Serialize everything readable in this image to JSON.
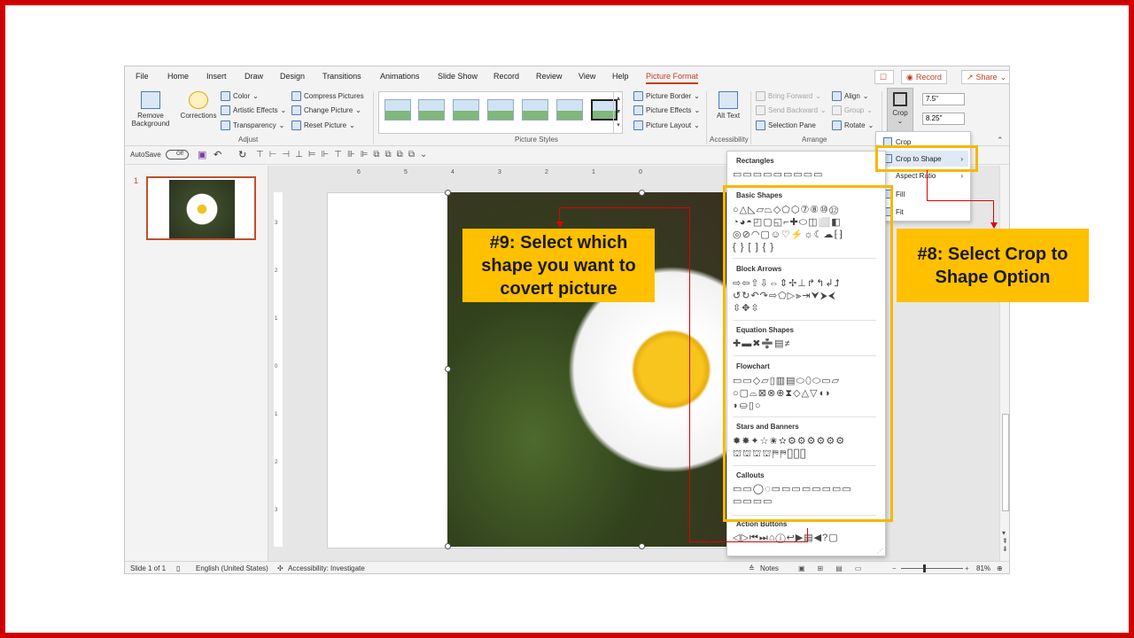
{
  "tabs": [
    "File",
    "Home",
    "Insert",
    "Draw",
    "Design",
    "Transitions",
    "Animations",
    "Slide Show",
    "Record",
    "Review",
    "View",
    "Help",
    "Picture Format"
  ],
  "title_buttons": {
    "record": "Record",
    "share": "Share"
  },
  "ribbon": {
    "adjust": {
      "remove_bg": "Remove Background",
      "corrections": "Corrections",
      "color": "Color",
      "artistic": "Artistic Effects",
      "transparency": "Transparency",
      "compress": "Compress Pictures",
      "change": "Change Picture",
      "reset": "Reset Picture",
      "group": "Adjust"
    },
    "styles": {
      "border": "Picture Border",
      "effects": "Picture Effects",
      "layout": "Picture Layout",
      "group": "Picture Styles"
    },
    "accessibility": {
      "alt_text": "Alt Text",
      "group": "Accessibility"
    },
    "arrange": {
      "bring_forward": "Bring Forward",
      "send_backward": "Send Backward",
      "selection_pane": "Selection Pane",
      "align": "Align",
      "group_btn": "Group",
      "rotate": "Rotate",
      "group": "Arrange"
    },
    "size": {
      "crop": "Crop",
      "height": "7.5\"",
      "width": "8.25\""
    }
  },
  "qat": {
    "autosave": "AutoSave",
    "toggle": "Off"
  },
  "slide_number": "1",
  "ruler_labels": [
    "6",
    "5",
    "4",
    "3",
    "2",
    "1",
    "0"
  ],
  "vruler_labels": [
    "3",
    "2",
    "1",
    "0",
    "1",
    "2",
    "3"
  ],
  "status": {
    "slide": "Slide 1 of 1",
    "language": "English (United States)",
    "accessibility": "Accessibility: Investigate",
    "notes": "Notes",
    "zoom": "81%"
  },
  "crop_menu": {
    "crop": "Crop",
    "crop_to_shape": "Crop to Shape",
    "aspect_ratio": "Aspect Ratio",
    "fill": "Fill",
    "fit": "Fit"
  },
  "shapes_gallery": {
    "rectangles": "Rectangles",
    "basic": "Basic Shapes",
    "arrows": "Block Arrows",
    "equation": "Equation Shapes",
    "flowchart": "Flowchart",
    "stars": "Stars and Banners",
    "callouts": "Callouts",
    "action": "Action Buttons"
  },
  "annotations": {
    "step8": "#8: Select Crop to Shape Option",
    "step9": "#9: Select which shape you want to covert picture"
  },
  "colors": {
    "frame": "#d10000",
    "highlight": "#ffc000",
    "accent": "#c43e1c"
  }
}
